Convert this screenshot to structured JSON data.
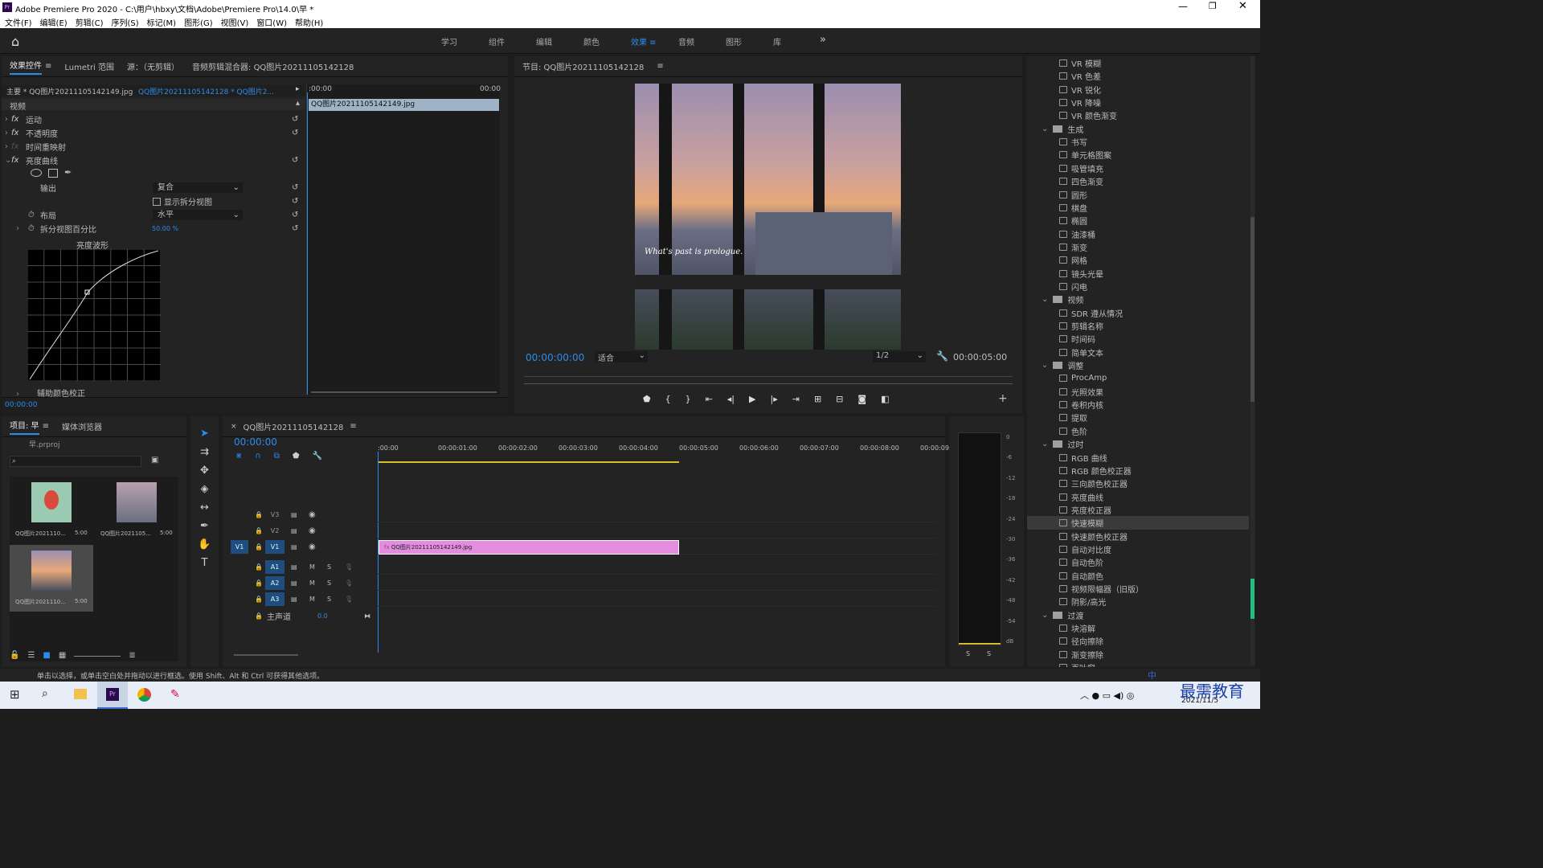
{
  "app": {
    "title": "Adobe Premiere Pro 2020 - C:\\用户\\hbxy\\文档\\Adobe\\Premiere Pro\\14.0\\早 *"
  },
  "menu": [
    "文件(F)",
    "编辑(E)",
    "剪辑(C)",
    "序列(S)",
    "标记(M)",
    "图形(G)",
    "视图(V)",
    "窗口(W)",
    "帮助(H)"
  ],
  "workspaces": [
    "学习",
    "组件",
    "编辑",
    "颜色",
    "效果",
    "音频",
    "图形",
    "库"
  ],
  "workspace_active": "效果",
  "ec": {
    "tabs": [
      "效果控件",
      "Lumetri 范围",
      "源：（无剪辑）",
      "音频剪辑混合器: QQ图片20211105142128"
    ],
    "master": "主要 * QQ图片20211105142149.jpg",
    "seq": "QQ图片20211105142128 * QQ图片2...",
    "t0": ":00:00",
    "t1": "00:00",
    "clip": "QQ图片20211105142149.jpg",
    "video": "视频",
    "motion": "运动",
    "opacity": "不透明度",
    "remap": "时间重映射",
    "curve": "亮度曲线",
    "out_l": "输出",
    "out_v": "复合",
    "split_v": "显示拆分视图",
    "layout_l": "布局",
    "layout_v": "水平",
    "pct_l": "拆分视图百分比",
    "pct_v": "50.00 %",
    "wave": "亮度波形",
    "aux": "辅助颜色校正",
    "tc": "00:00:00"
  },
  "prog": {
    "title": "节目: QQ图片20211105142128",
    "caption": "What's past is prologue.",
    "tc": "00:00:00:00",
    "fit": "适合",
    "res": "1/2",
    "dur": "00:00:05:00"
  },
  "effects": [
    {
      "n": "VR 模糊",
      "f": 0
    },
    {
      "n": "VR 色差",
      "f": 0
    },
    {
      "n": "VR 锐化",
      "f": 0
    },
    {
      "n": "VR 降噪",
      "f": 0
    },
    {
      "n": "VR 颜色渐变",
      "f": 0
    },
    {
      "n": "生成",
      "f": 1
    },
    {
      "n": "书写",
      "f": 0
    },
    {
      "n": "单元格图案",
      "f": 0
    },
    {
      "n": "吸管填充",
      "f": 0
    },
    {
      "n": "四色渐变",
      "f": 0
    },
    {
      "n": "圆形",
      "f": 0
    },
    {
      "n": "棋盘",
      "f": 0
    },
    {
      "n": "椭圆",
      "f": 0
    },
    {
      "n": "油漆桶",
      "f": 0
    },
    {
      "n": "渐变",
      "f": 0
    },
    {
      "n": "网格",
      "f": 0
    },
    {
      "n": "镜头光晕",
      "f": 0
    },
    {
      "n": "闪电",
      "f": 0
    },
    {
      "n": "视频",
      "f": 1
    },
    {
      "n": "SDR 遵从情况",
      "f": 0
    },
    {
      "n": "剪辑名称",
      "f": 0
    },
    {
      "n": "时间码",
      "f": 0
    },
    {
      "n": "简单文本",
      "f": 0
    },
    {
      "n": "调整",
      "f": 1
    },
    {
      "n": "ProcAmp",
      "f": 0
    },
    {
      "n": "光照效果",
      "f": 0
    },
    {
      "n": "卷积内核",
      "f": 0
    },
    {
      "n": "提取",
      "f": 0
    },
    {
      "n": "色阶",
      "f": 0
    },
    {
      "n": "过时",
      "f": 1
    },
    {
      "n": "RGB 曲线",
      "f": 0
    },
    {
      "n": "RGB 颜色校正器",
      "f": 0
    },
    {
      "n": "三向颜色校正器",
      "f": 0
    },
    {
      "n": "亮度曲线",
      "f": 0
    },
    {
      "n": "亮度校正器",
      "f": 0
    },
    {
      "n": "快速模糊",
      "f": 0,
      "sel": 1
    },
    {
      "n": "快速颜色校正器",
      "f": 0
    },
    {
      "n": "自动对比度",
      "f": 0
    },
    {
      "n": "自动色阶",
      "f": 0
    },
    {
      "n": "自动颜色",
      "f": 0
    },
    {
      "n": "视频限幅器（旧版）",
      "f": 0
    },
    {
      "n": "阴影/高光",
      "f": 0
    },
    {
      "n": "过渡",
      "f": 1
    },
    {
      "n": "块溶解",
      "f": 0
    },
    {
      "n": "径向擦除",
      "f": 0
    },
    {
      "n": "渐变擦除",
      "f": 0
    },
    {
      "n": "百叶窗",
      "f": 0
    }
  ],
  "project": {
    "tabs": [
      "项目: 早",
      "媒体浏览器"
    ],
    "file": "早.prproj",
    "items": [
      {
        "n": "QQ图片2021110...",
        "d": "5:00"
      },
      {
        "n": "QQ图片2021105...",
        "d": "5:00"
      },
      {
        "n": "QQ图片2021110...",
        "d": "5:00"
      }
    ]
  },
  "timeline": {
    "tab": "QQ图片20211105142128",
    "tc": "00:00:00",
    "ruler": [
      ":00:00",
      "00:00:01:00",
      "00:00:02:00",
      "00:00:03:00",
      "00:00:04:00",
      "00:00:05:00",
      "00:00:06:00",
      "00:00:07:00",
      "00:00:08:00",
      "00:00:09:"
    ],
    "vtracks": [
      "V3",
      "V2",
      "V1"
    ],
    "atracks": [
      "A1",
      "A2",
      "A3"
    ],
    "master": "主声道",
    "mval": "0.0",
    "src": "V1",
    "clip": "QQ图片20211105142149.jpg"
  },
  "meter": {
    "scale": [
      "0",
      "-6",
      "-12",
      "-18",
      "-24",
      "-30",
      "-36",
      "-42",
      "-48",
      "-54",
      "dB"
    ],
    "s": "S"
  },
  "status": "单击以选择，或单击空白处并拖动以进行框选。使用 Shift、Alt 和 Ctrl 可获得其他选项。",
  "taskbar": {
    "date": "2021/11/5",
    "brand": "最需教育",
    "ime": "中"
  }
}
